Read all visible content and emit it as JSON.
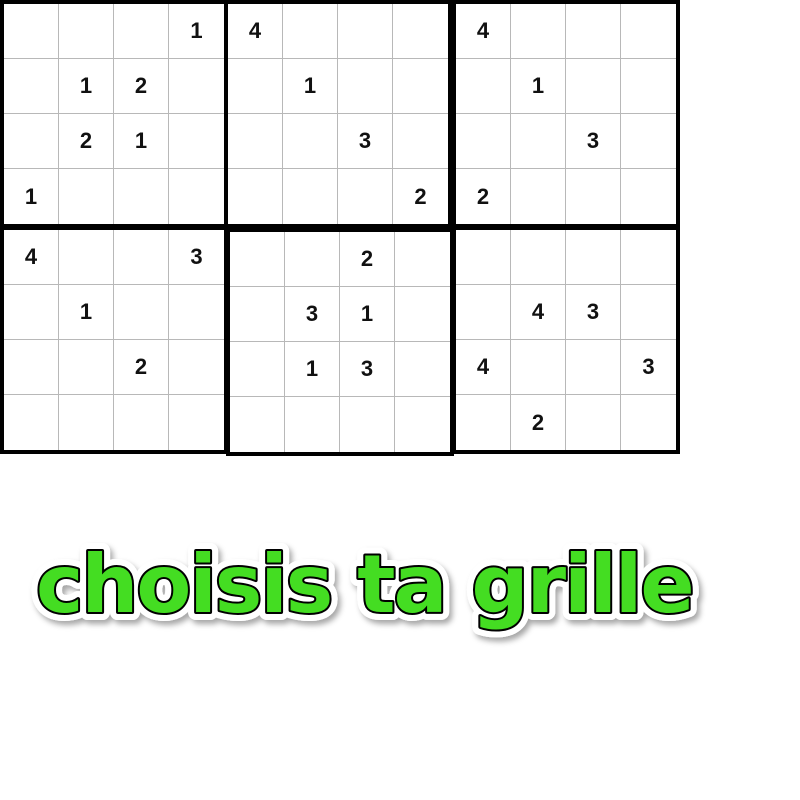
{
  "grids": [
    {
      "name": "grid-1",
      "cells": [
        "",
        "",
        "",
        "1",
        "",
        "1",
        "2",
        "",
        "",
        "2",
        "1",
        "",
        "1",
        "",
        "",
        ""
      ]
    },
    {
      "name": "grid-2",
      "cells": [
        "4",
        "",
        "",
        "",
        "",
        "1",
        "",
        "",
        "",
        "",
        "3",
        "",
        "",
        "",
        "",
        "2"
      ]
    },
    {
      "name": "grid-3",
      "cells": [
        "4",
        "",
        "",
        "",
        "",
        "1",
        "",
        "",
        "",
        "",
        "3",
        "",
        "2",
        "",
        "",
        ""
      ]
    },
    {
      "name": "grid-4",
      "cells": [
        "4",
        "",
        "",
        "3",
        "",
        "1",
        "",
        "",
        "",
        "",
        "2",
        "",
        "",
        "",
        "",
        ""
      ]
    },
    {
      "name": "grid-5",
      "cells": [
        "",
        "",
        "2",
        "",
        "",
        "3",
        "1",
        "",
        "",
        "1",
        "3",
        "",
        "",
        "",
        "",
        ""
      ]
    },
    {
      "name": "grid-6",
      "cells": [
        "",
        "",
        "",
        "",
        "",
        "4",
        "3",
        "",
        "4",
        "",
        "",
        "3",
        "",
        "2",
        "",
        ""
      ]
    }
  ],
  "title": "choisis ta grille",
  "colors": {
    "title_fill": "#44dd22",
    "title_outline": "#000000",
    "title_halo": "#ffffff",
    "grid_border": "#000000",
    "cell_line": "#b8b8b8",
    "digit": "#111111",
    "selection": "#8ab0d8"
  }
}
